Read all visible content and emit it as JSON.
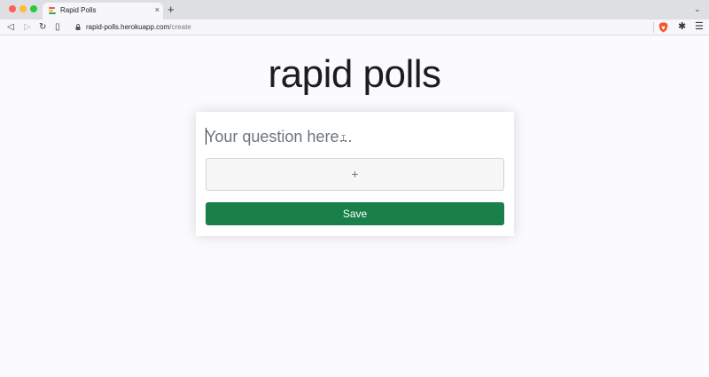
{
  "browser": {
    "tab_title": "Rapid Polls",
    "tab_close": "×",
    "new_tab": "+",
    "tab_menu": "⌄",
    "url_host": "rapid-polls.herokuapp.com",
    "url_path": "/create",
    "icons": {
      "back": "◁",
      "forward": "▷",
      "reload": "↻",
      "bookmark": "▯",
      "extensions": "✱",
      "menu": "☰"
    },
    "colors": {
      "brave": "#fb542b"
    }
  },
  "page": {
    "title": "rapid polls",
    "question_placeholder": "Your question here...",
    "add_option_label": "+",
    "save_label": "Save",
    "colors": {
      "save_button": "#198049"
    }
  }
}
